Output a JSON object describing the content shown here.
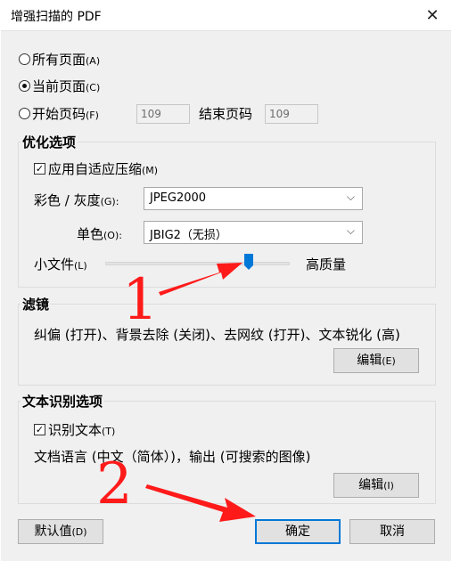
{
  "window": {
    "title": "增强扫描的 PDF",
    "close_glyph": "✕"
  },
  "pages": {
    "all": {
      "label": "所有页面",
      "key": "(A)"
    },
    "current": {
      "label": "当前页面",
      "key": "(C)"
    },
    "start": {
      "label": "开始页码",
      "key": "(F)"
    },
    "start_value": "109",
    "end_label": "结束页码",
    "end_value": "109"
  },
  "optimize": {
    "title": "优化选项",
    "adaptive": {
      "label": "应用自适应压缩",
      "key": "(M)"
    },
    "color_label": "彩色 / 灰度",
    "color_key": "(G):",
    "color_value": "JPEG2000",
    "mono_label": "单色",
    "mono_key": "(O):",
    "mono_value": "JBIG2（无损）",
    "small_label": "小文件",
    "small_key": "(L)",
    "high_label": "高质量",
    "quality_level": 0.78
  },
  "filter": {
    "title": "滤镜",
    "summary": "纠偏 (打开)、背景去除 (关闭)、去网纹 (打开)、文本锐化 (高)",
    "edit_label": "编辑",
    "edit_key": "(E)"
  },
  "ocr": {
    "title": "文本识别选项",
    "recognize": {
      "label": "识别文本",
      "key": "(T)"
    },
    "summary": "文档语言 (中文（简体）)，输出 (可搜索的图像)",
    "edit_label": "编辑",
    "edit_key": "(I)"
  },
  "footer": {
    "defaults_label": "默认值",
    "defaults_key": "(D)",
    "ok_label": "确定",
    "cancel_label": "取消"
  },
  "annotations": {
    "one": "1",
    "two": "2",
    "arrow_color": "#ff1a1a"
  }
}
